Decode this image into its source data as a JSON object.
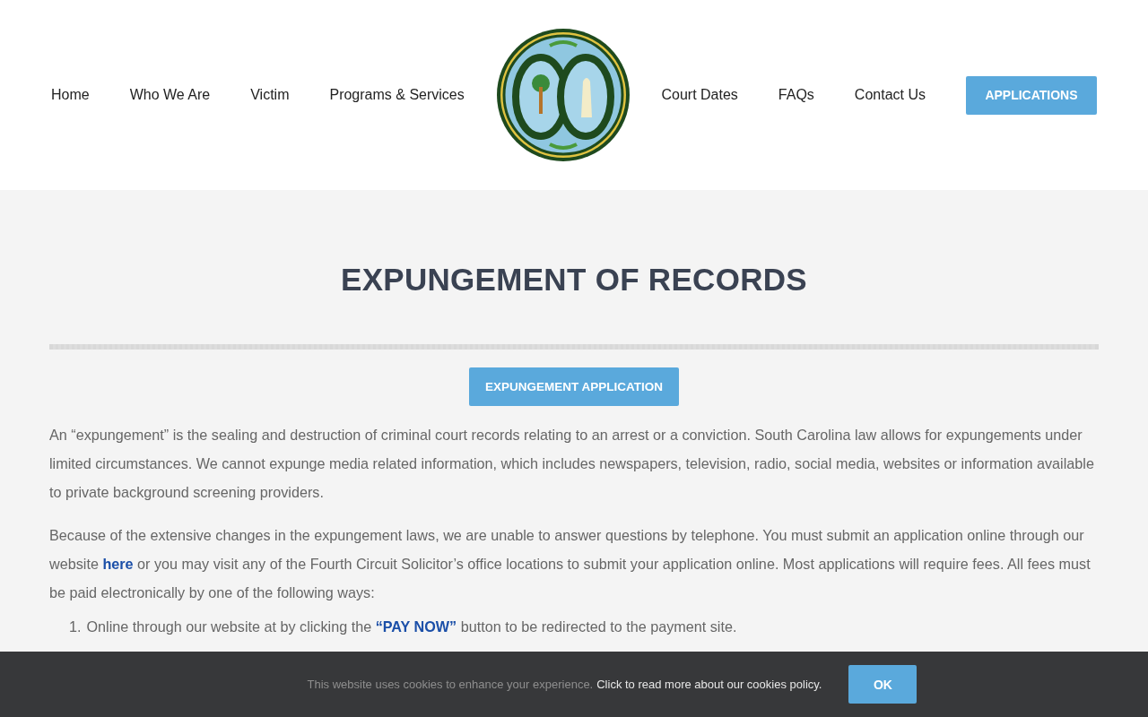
{
  "nav_left": [
    {
      "label": "Home"
    },
    {
      "label": "Who We Are"
    },
    {
      "label": "Victim"
    },
    {
      "label": "Programs & Services"
    }
  ],
  "nav_right": [
    {
      "label": "Court Dates"
    },
    {
      "label": "FAQs"
    },
    {
      "label": "Contact Us"
    }
  ],
  "header_button": "APPLICATIONS",
  "title": "EXPUNGEMENT OF RECORDS",
  "action_button": "EXPUNGEMENT APPLICATION",
  "paragraphs": [
    {
      "before": "An “expungement” is the sealing and destruction of criminal court records relating to an arrest or a conviction. South Carolina law allows for expungements under limited circumstances. We cannot expunge media related information, which includes newspapers, television, radio, social media, websites or information available to private background screening providers."
    },
    {
      "before": "Because of the extensive changes in the expungement laws, we are unable to answer questions by telephone. You must submit an application online through our website ",
      "link": "here",
      "after": " or you may visit any of the Fourth Circuit Solicitor’s office locations to submit your application online. Most applications will require fees. All fees must be paid electronically by one of the following ways:"
    }
  ],
  "list": [
    {
      "number": "1.",
      "before": "Online through our website at by clicking the ",
      "link": "“PAY NOW”",
      "after": " button to be redirected to the payment site."
    }
  ],
  "cookie_bar": {
    "text": "This website uses cookies to enhance your experience.",
    "link": "Click to read more about our cookies policy.",
    "button": "OK"
  }
}
